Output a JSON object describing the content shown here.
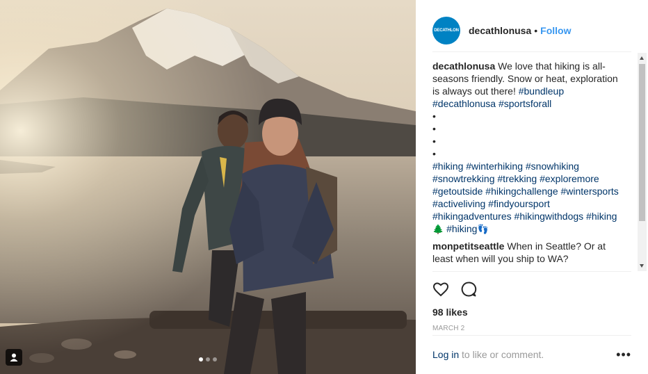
{
  "post": {
    "account": {
      "username": "decathlonusa",
      "avatar_text": "DECATHLON",
      "follow_label": "Follow",
      "separator": "•"
    },
    "caption": {
      "author": "decathlonusa",
      "text": "We love that hiking is all-seasons friendly. Snow or heat, exploration is always out there!",
      "inline_tags": [
        "#bundleup",
        "#decathlonusa",
        "#sportsforall"
      ],
      "bullets": [
        "•",
        "•",
        "•",
        "•"
      ],
      "hashtags": [
        "#hiking",
        "#winterhiking",
        "#snowhiking",
        "#snowtrekking",
        "#trekking",
        "#exploremore",
        "#getoutside",
        "#hikingchallenge",
        "#wintersports",
        "#activeliving",
        "#findyoursport",
        "#hikingadventures",
        "#hikingwithdogs"
      ],
      "last_line": {
        "tag1": "#hiking",
        "emoji1": "🌲",
        "tag2": "#hiking",
        "emoji2": "👣"
      }
    },
    "comments": [
      {
        "author": "monpetitseattle",
        "text": "When in Seattle? Or at least when will you ship to WA?"
      }
    ],
    "likes": "98 likes",
    "date": "MARCH 2",
    "login": {
      "link": "Log in",
      "text": "to like or comment."
    },
    "more_label": "•••",
    "carousel": {
      "count": 3,
      "active_index": 0
    },
    "icons": {
      "like": "heart-icon",
      "comment": "comment-icon",
      "user_tag": "user-tag-icon",
      "more": "more-options-icon"
    },
    "colors": {
      "link_blue": "#3897f0",
      "hashtag": "#003569",
      "brand_avatar": "#0082c3",
      "muted": "#999999"
    }
  }
}
